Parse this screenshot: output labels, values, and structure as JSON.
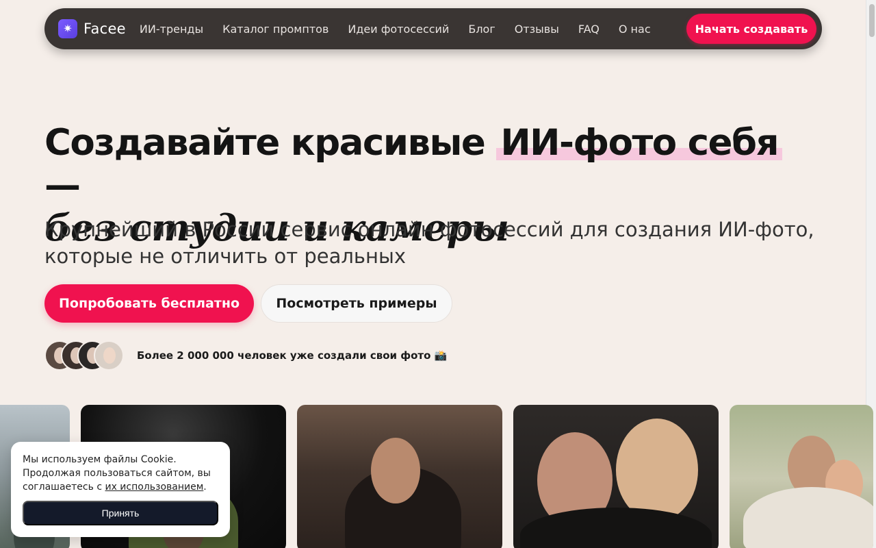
{
  "nav": {
    "logo_text": "Facee",
    "logo_icon": "sparkle-icon",
    "links": [
      "ИИ-тренды",
      "Каталог промптов",
      "Идеи фотосессий",
      "Блог",
      "Отзывы",
      "FAQ",
      "О нас"
    ],
    "cta_label": "Начать создавать"
  },
  "hero": {
    "title_part1": "Создавайте красивые ",
    "title_highlight": "ИИ-фото себя",
    "title_part2": " —",
    "title_italic": "без студии и камеры",
    "subtitle": "Крупнейший в России сервис онлайн фотосессий для создания ИИ-фото, которые не отличить от реальных",
    "primary_button": "Попробовать бесплатно",
    "secondary_button": "Посмотреть примеры",
    "social_proof": "Более 2 000 000 человек уже создали свои фото 📸"
  },
  "cookie": {
    "text_before_link": "Мы используем файлы Cookie. Продолжая пользоваться сайтом, вы соглашаетесь с ",
    "link_text": "их использованием",
    "text_after_link": ".",
    "accept_label": "Принять"
  },
  "colors": {
    "background": "#f5eee9",
    "nav_bg": "#3a3533",
    "accent": "#f0124f",
    "highlight": "#f6c8dd",
    "cookie_button": "#141a2a"
  }
}
